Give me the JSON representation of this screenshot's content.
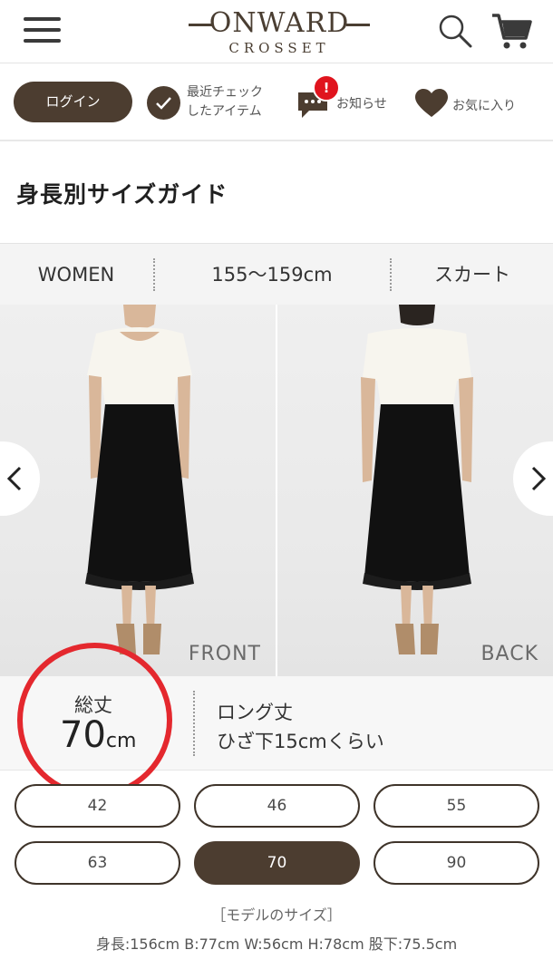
{
  "header": {
    "logo_main": "ONWARD",
    "logo_sub": "CROSSET"
  },
  "subnav": {
    "login_label": "ログイン",
    "recent_line1": "最近チェック",
    "recent_line2": "したアイテム",
    "notice_badge": "!",
    "notice_label": "お知らせ",
    "favorites_label": "お気に入り"
  },
  "page_title": "身長別サイズガイド",
  "filters": {
    "gender": "WOMEN",
    "height": "155〜159cm",
    "category": "スカート"
  },
  "photos": {
    "front_label": "FRONT",
    "back_label": "BACK"
  },
  "length": {
    "label": "総丈",
    "value": "70",
    "unit": "cm",
    "desc_line1": "ロング丈",
    "desc_line2": "ひざ下15cmくらい"
  },
  "sizes": [
    {
      "label": "42",
      "active": false
    },
    {
      "label": "46",
      "active": false
    },
    {
      "label": "55",
      "active": false
    },
    {
      "label": "63",
      "active": false
    },
    {
      "label": "70",
      "active": true
    },
    {
      "label": "90",
      "active": false
    }
  ],
  "model": {
    "title": "［モデルのサイズ］",
    "detail": "身長:156cm B:77cm W:56cm H:78cm 股下:75.5cm"
  },
  "colors": {
    "brand_brown": "#4c3d30",
    "notice_red": "#e0141e",
    "highlight_circle": "#e4282e"
  }
}
